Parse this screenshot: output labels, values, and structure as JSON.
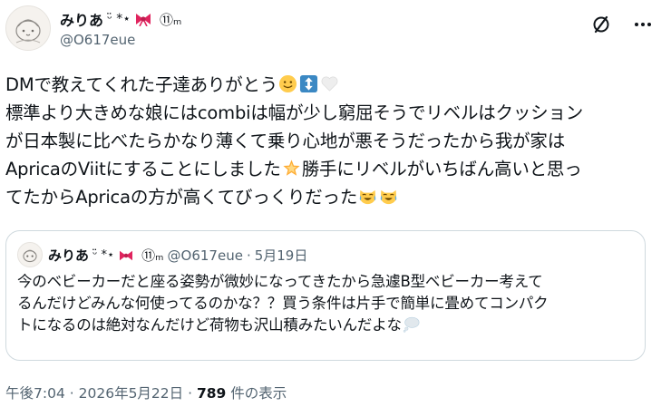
{
  "author": {
    "display_name": "みりあ",
    "name_decor": "ᵕ̈ *⋆",
    "badge": "⑪ₘ",
    "handle": "@O617eue"
  },
  "tweet": {
    "line1": "DMで教えてくれた子達ありがとう",
    "line2": "標準より大きめな娘にはcombiは幅が少し窮屈そうでリベルはクッション",
    "line3": "が日本製に比べたらかなり薄くて乗り心地が悪そうだったから我が家は",
    "line4a": "ApricaのViitにすることにしました",
    "line4b": "勝手にリベルがいちばん高いと思っ",
    "line5": "てたからApricaの方が高くてびっくりだった"
  },
  "quote": {
    "display_name": "みりあ",
    "name_decor": "ᵕ̈ *⋆",
    "badge": "⑪ₘ",
    "handle": "@O617eue",
    "separator": "·",
    "date": "5月19日",
    "line1": "今のベビーカーだと座る姿勢が微妙になってきたから急遽B型ベビーカー考えて",
    "line2": "るんだけどみんな何使ってるのかな？？買う条件は片手で簡単に畳めてコンパク",
    "line3": "トになるのは絶対なんだけど荷物も沢山積みたいんだよな"
  },
  "footer": {
    "time": "午後7:04",
    "separator": "·",
    "date": "2026年5月22日",
    "separator2": "·",
    "views_count": "789",
    "views_label": "件の表示"
  },
  "icons": {
    "grok": "grok-slash-icon",
    "more": "more-dots-icon"
  },
  "colors": {
    "text": "#0f1419",
    "secondary": "#536471",
    "border": "#cfd9de",
    "bow": "#e0245e",
    "updown": "#3b88c3"
  }
}
